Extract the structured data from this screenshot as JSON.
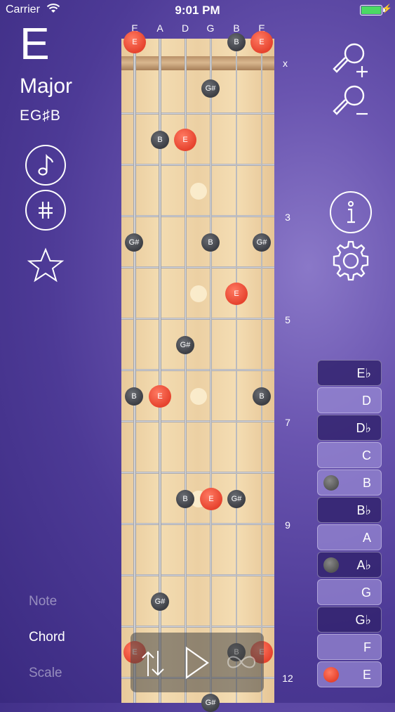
{
  "status_bar": {
    "carrier": "Carrier",
    "time": "9:01 PM"
  },
  "chord": {
    "root": "E",
    "quality": "Major",
    "notes": "EG♯B"
  },
  "left_icons": [
    "music-note-icon",
    "sharp-icon",
    "star-icon"
  ],
  "right_icons": [
    "zoom-in-icon",
    "zoom-out-icon",
    "info-icon",
    "gear-icon"
  ],
  "strings": [
    "E",
    "A",
    "D",
    "G",
    "B",
    "E"
  ],
  "nut_marker": "x",
  "fret_numbers": [
    "3",
    "5",
    "7",
    "9",
    "12"
  ],
  "fret_notes": {
    "open_e_low": "E",
    "open_b": "B",
    "open_e_high": "E",
    "f1_g": "G#",
    "f2_a": "B",
    "f2_d": "E",
    "f4_e": "G#",
    "f4_g": "B",
    "f4_b": "G#",
    "f5_b": "E",
    "f6_d": "G#",
    "f7_e": "B",
    "f7_a": "E",
    "f7_e2": "B",
    "f9_d": "B",
    "f9_g": "E",
    "f9_b": "G#",
    "f11_a": "G#",
    "f12_e": "E",
    "f12_b": "B",
    "f12_e2": "E",
    "f13_g": "G#"
  },
  "keys": [
    {
      "label": "E♭",
      "type": "black",
      "dot": null
    },
    {
      "label": "D",
      "type": "white",
      "dot": null
    },
    {
      "label": "D♭",
      "type": "black",
      "dot": null
    },
    {
      "label": "C",
      "type": "white",
      "dot": null
    },
    {
      "label": "B",
      "type": "white",
      "dot": "gray"
    },
    {
      "label": "B♭",
      "type": "black",
      "dot": null
    },
    {
      "label": "A",
      "type": "white",
      "dot": null
    },
    {
      "label": "A♭",
      "type": "black",
      "dot": "gray"
    },
    {
      "label": "G",
      "type": "white",
      "dot": null
    },
    {
      "label": "G♭",
      "type": "black",
      "dot": null
    },
    {
      "label": "F",
      "type": "white",
      "dot": null
    },
    {
      "label": "E",
      "type": "white",
      "dot": "red"
    }
  ],
  "modes": {
    "note": "Note",
    "chord": "Chord",
    "scale": "Scale",
    "active": "Chord"
  },
  "player": [
    "flip-icon",
    "play-icon",
    "loop-icon"
  ],
  "colors": {
    "root_note": "#e6432e",
    "chord_tone": "#4a4c52",
    "accent": "#6a55b0"
  }
}
